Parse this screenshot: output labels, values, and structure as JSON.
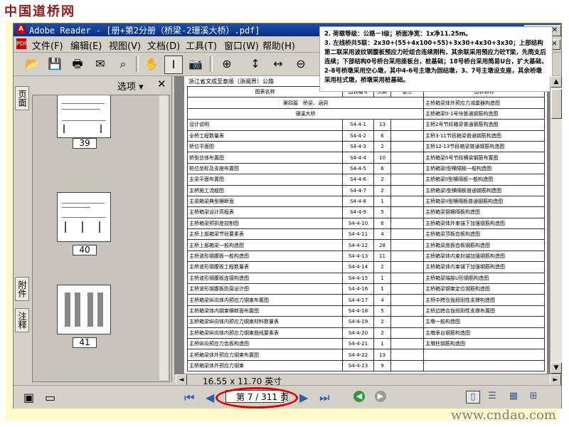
{
  "watermark": {
    "top": "中国道桥网",
    "bottom": "www.cndao.com"
  },
  "window": {
    "app_label": "A",
    "title": "Adobe Reader - [册+第2分册（桥梁-2珊溪大桥）.pdf]"
  },
  "menu": {
    "pdf_icon": "PDF",
    "items": [
      "文件(F)",
      "编辑(E)",
      "视图(V)",
      "文档(D)",
      "工具(T)",
      "窗口(W)",
      "帮助(H)"
    ]
  },
  "toolbar": {
    "icons": [
      "open-icon",
      "save-icon",
      "print-icon",
      "email-icon",
      "search-binoculars-icon",
      "hand-tool-icon",
      "select-text-icon",
      "snapshot-icon",
      "zoom-in-icon",
      "fit-page-icon",
      "fit-width-icon",
      "zoom-out-icon"
    ]
  },
  "side_tabs": [
    "页面",
    "附件",
    "注释"
  ],
  "side_panel": {
    "options_label": "选项 ▾",
    "close_glyph": "✕",
    "thumbnails": [
      "39",
      "40",
      "41"
    ]
  },
  "document": {
    "header": "浙江省文成至泰顺（浙闽界）公路",
    "table_headers": [
      "图表名称",
      "图表编号",
      "页数",
      "备注",
      "图表名称"
    ],
    "section_row": "第四篇　桥梁、涵洞",
    "bridge_row": "珊溪大桥",
    "rows": [
      [
        "设计说明",
        "S4-4-1",
        "13",
        "",
        "主桥箱梁体外预应力减震器构造图"
      ],
      [
        "全桥工程数量表",
        "S4-4-2",
        "6",
        "",
        "主桥箱梁0-1号块普通钢筋构造图"
      ],
      [
        "桥位平面图",
        "S4-4-3",
        "2",
        "",
        "主桥2号节段箱梁普通钢筋构造图"
      ],
      [
        "桥型总体布置图",
        "S4-4-4",
        "10",
        "",
        "主桥3-11节段箱梁普通钢筋构造图"
      ],
      [
        "桩位坐标及支座布置图",
        "S4-4-5",
        "6",
        "",
        "主桥12-13节段箱梁普通钢筋构造图"
      ],
      [
        "主梁平面布置图",
        "S4-4-6",
        "2",
        "",
        "主桥箱梁0号节段横梁钢筋布置图"
      ],
      [
        "主桥施工流程图",
        "S4-4-7",
        "2",
        "",
        "主桥箱梁I型横隔板一般构造图"
      ],
      [
        "主梁箱梁典型横断面",
        "S4-4-8",
        "1",
        "",
        "主桥箱梁II型横隔板一般构造图"
      ],
      [
        "主桥箱梁设计高程表",
        "S4-4-9",
        "5",
        "",
        "主桥箱梁I型横隔板普通钢筋构造图"
      ],
      [
        "主桥箱梁预拱度控制图",
        "S4-4-10",
        "6",
        "",
        "主桥箱梁II型横隔板普通钢筋构造图"
      ],
      [
        "主桥上部箱梁节段要素表",
        "S4-4-11",
        "4",
        "",
        "主桥箱梁钢横隔板构造图"
      ],
      [
        "主桥上部箱梁一般构造图",
        "S4-4-12",
        "28",
        "",
        "主桥箱梁体外束锚下加强钢筋构造图"
      ],
      [
        "主桥波形钢腹板一般构造图",
        "S4-4-13",
        "11",
        "",
        "主桥箱梁顶板齿板构造图"
      ],
      [
        "主桥波形钢腹板工程数量表",
        "S4-4-14",
        "2",
        "",
        "主桥箱梁底板齿板钢筋构造图"
      ],
      [
        "主桥波形钢腹板连接构造图",
        "S4-4-15",
        "1",
        "",
        "主桥箱梁体内束封锚加强钢筋构造图"
      ],
      [
        "主桥波形钢腹板防腐设计图",
        "S4-4-16",
        "1",
        "",
        "主桥箱梁体内束锚下加强钢筋构造图"
      ],
      [
        "主桥箱梁纵向体内预应力钢束布置图",
        "S4-4-17",
        "4",
        "",
        "主桥箱梁端部U形钢筋构造图"
      ],
      [
        "主桥箱梁体内钢束横断面布置图",
        "S4-4-18",
        "5",
        "",
        "主桥箱梁钢束定位钢筋构造图"
      ],
      [
        "主桥箱梁纵向体内预应力钢束材料数量表",
        "S4-4-19",
        "2",
        "",
        "主桥中跨合拢段刚性支撑构造图"
      ],
      [
        "主桥箱梁纵向体内预应力钢束曲线要素表",
        "S4-4-20",
        "2",
        "",
        "主桥边跨合拢段刚性支撑布置图"
      ],
      [
        "主桥纵向预应力齿板构造图",
        "S4-4-21",
        "1",
        "",
        "主墩一般构造图"
      ],
      [
        "主桥箱梁体外预应力钢束布置图",
        "S4-4-22",
        "13",
        "",
        "主墩承台钢筋构造图"
      ],
      [
        "主桥箱梁体外预应力钢束",
        "S4-4-23",
        "9",
        "",
        "主墩柱钢筋构造图"
      ]
    ]
  },
  "note": {
    "lines": [
      "2. 荷载等级：公路－I级；桥面净宽：1x净11.25m。",
      "3. 左线桥共5联：2x30+(55+4x100+55)+3x30+4x30+3x30；上部结构第二联采用波纹钢腹板预应力砼组合连续刚构，其余联采用预应力砼T梁，先简支后连续；下部结构0号桥台采用座板台，桩基础；18号桥台采用简易U台，扩大基础，2-8号桥墩采用空心墩，其中4-6号主墩为固结墩，3、7号主墩设支座，其余桥墩采用柱式墩，桥墩采用桩基础。"
    ]
  },
  "status": {
    "page_size": "16.55 x 11.70 英寸",
    "page_indicator": "第 7 / 311 页",
    "current_page": 7,
    "total_pages": 311
  },
  "colors": {
    "title_bar": "#0b2e82",
    "highlight_circle": "#e00000",
    "frame": "#fff9cc"
  }
}
